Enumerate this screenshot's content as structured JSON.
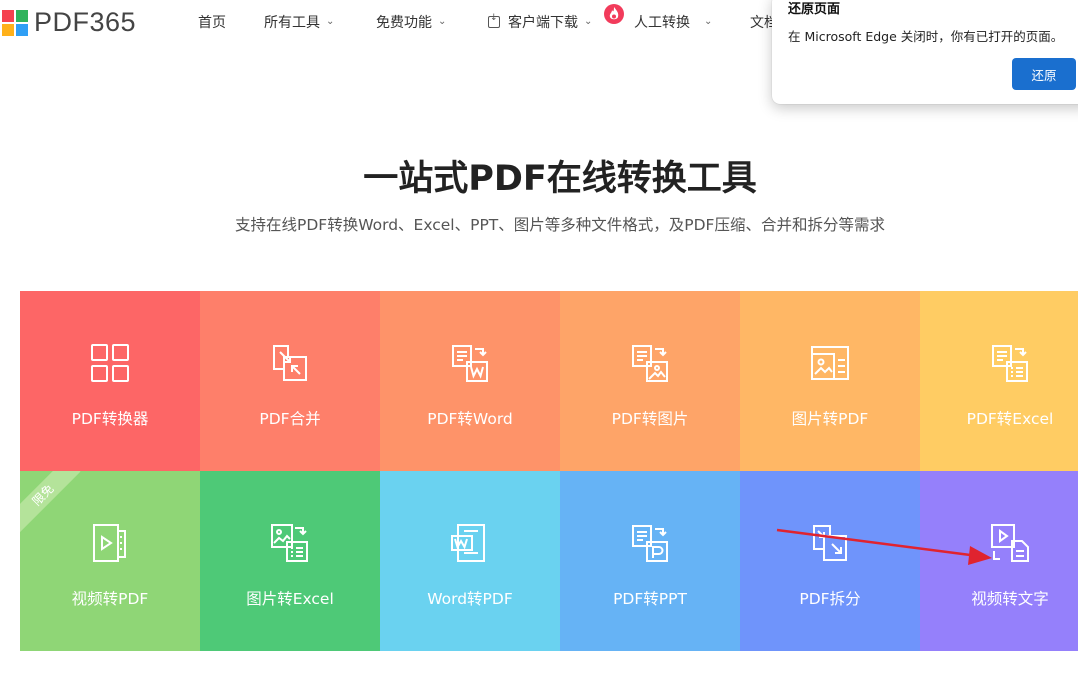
{
  "header": {
    "logo_text": "PDF365",
    "logo_colors": [
      "#f5424f",
      "#30b35c",
      "#ffb11a",
      "#2f9ff5"
    ],
    "nav": {
      "home": "首页",
      "all_tools": "所有工具",
      "free_features": "免费功能",
      "client_download": "客户端下载",
      "manual_convert": "人工转换",
      "doc": "文档"
    }
  },
  "edge_popup": {
    "title": "还原页面",
    "message": "在 Microsoft Edge 关闭时，你有已打开的页面。",
    "restore_button": "还原",
    "button_color": "#1a6fcf"
  },
  "hero": {
    "title": "一站式PDF在线转换工具",
    "subtitle": "支持在线PDF转换Word、Excel、PPT、图片等多种文件格式，及PDF压缩、合并和拆分等需求"
  },
  "tools": [
    {
      "label": "PDF转换器",
      "icon": "grid-icon",
      "color": "#fd6666"
    },
    {
      "label": "PDF合并",
      "icon": "merge-icon",
      "color": "#fe7f6a"
    },
    {
      "label": "PDF转Word",
      "icon": "pdf-to-word-icon",
      "color": "#fe9369"
    },
    {
      "label": "PDF转图片",
      "icon": "pdf-to-image-icon",
      "color": "#fea468"
    },
    {
      "label": "图片转PDF",
      "icon": "image-to-pdf-icon",
      "color": "#ffb765"
    },
    {
      "label": "PDF转Excel",
      "icon": "pdf-to-excel-icon",
      "color": "#ffcc63"
    },
    {
      "label": "视频转PDF",
      "icon": "video-to-pdf-icon",
      "color": "#8fd676",
      "badge": "限免"
    },
    {
      "label": "图片转Excel",
      "icon": "image-to-excel-icon",
      "color": "#4ec977"
    },
    {
      "label": "Word转PDF",
      "icon": "word-to-pdf-icon",
      "color": "#6ad2f0"
    },
    {
      "label": "PDF转PPT",
      "icon": "pdf-to-ppt-icon",
      "color": "#66b3f5"
    },
    {
      "label": "PDF拆分",
      "icon": "pdf-split-icon",
      "color": "#6f94fb"
    },
    {
      "label": "视频转文字",
      "icon": "video-to-text-icon",
      "color": "#9580fb"
    }
  ],
  "annotation": {
    "color": "#e0232f"
  }
}
